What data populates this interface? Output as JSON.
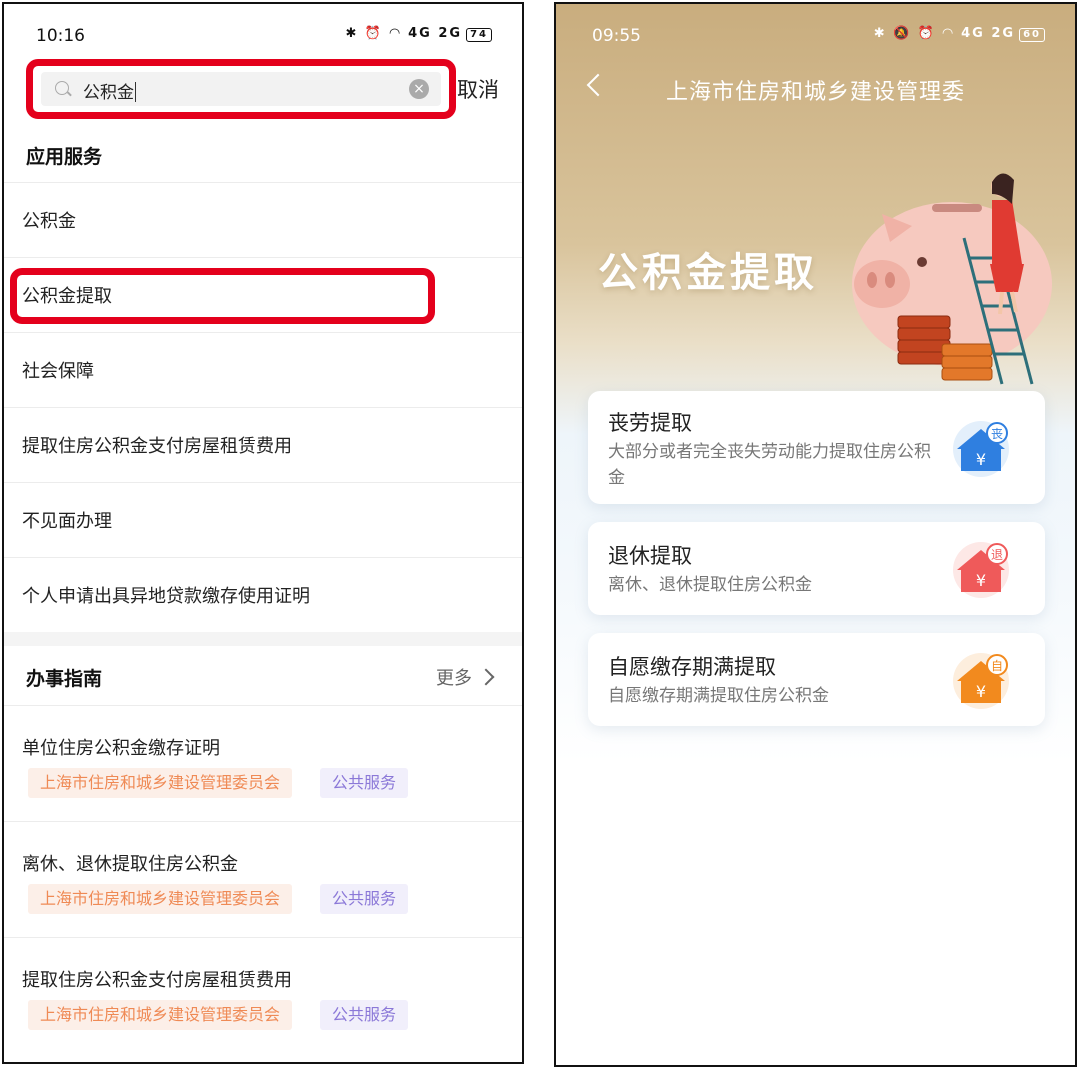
{
  "left": {
    "status": {
      "time": "10:16",
      "icons": "✱ ⏰ ◠ 4G 2G",
      "battery": "74"
    },
    "search": {
      "value": "公积金",
      "cancel_label": "取消"
    },
    "app_services": {
      "title": "应用服务",
      "items": [
        {
          "label": "公积金"
        },
        {
          "label": "公积金提取"
        },
        {
          "label": "社会保障"
        },
        {
          "label": "提取住房公积金支付房屋租赁费用"
        },
        {
          "label": "不见面办理"
        },
        {
          "label": "个人申请出具异地贷款缴存使用证明"
        }
      ]
    },
    "guides": {
      "title": "办事指南",
      "more_label": "更多",
      "items": [
        {
          "title": "单位住房公积金缴存证明",
          "org_tag": "上海市住房和城乡建设管理委员会",
          "type_tag": "公共服务"
        },
        {
          "title": "离休、退休提取住房公积金",
          "org_tag": "上海市住房和城乡建设管理委员会",
          "type_tag": "公共服务"
        },
        {
          "title": "提取住房公积金支付房屋租赁费用",
          "org_tag": "上海市住房和城乡建设管理委员会",
          "type_tag": "公共服务"
        }
      ]
    }
  },
  "right": {
    "status": {
      "time": "09:55",
      "icons": "✱ 🔕 ⏰ ◠ 4G 2G",
      "battery": "60"
    },
    "nav_title": "上海市住房和城乡建设管理委",
    "hero_title": "公积金提取",
    "cards": [
      {
        "title": "丧劳提取",
        "desc": "大部分或者完全丧失劳动能力提取住房公积金",
        "badge": "丧",
        "color": "#2f7fe0"
      },
      {
        "title": "退休提取",
        "desc": "离休、退休提取住房公积金",
        "badge": "退",
        "color": "#ef5a5a"
      },
      {
        "title": "自愿缴存期满提取",
        "desc": "自愿缴存期满提取住房公积金",
        "badge": "自",
        "color": "#f28a1e"
      }
    ]
  }
}
